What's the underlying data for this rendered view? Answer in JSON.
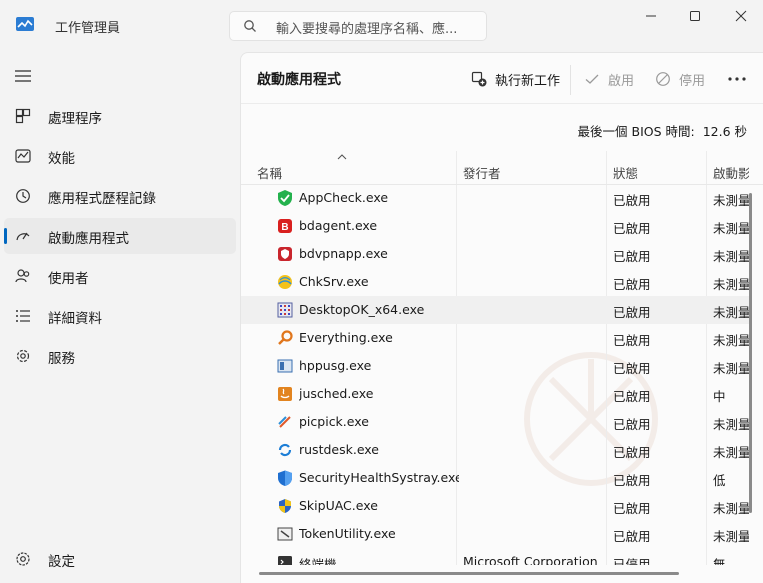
{
  "window": {
    "title": "工作管理員",
    "search_placeholder": "輸入要搜尋的處理序名稱、應..."
  },
  "sidebar": {
    "items": [
      {
        "label": "處理程序",
        "icon": "processes-icon"
      },
      {
        "label": "效能",
        "icon": "performance-icon"
      },
      {
        "label": "應用程式歷程記錄",
        "icon": "app-history-icon"
      },
      {
        "label": "啟動應用程式",
        "icon": "startup-apps-icon",
        "active": true
      },
      {
        "label": "使用者",
        "icon": "users-icon"
      },
      {
        "label": "詳細資料",
        "icon": "details-icon"
      },
      {
        "label": "服務",
        "icon": "services-icon"
      }
    ],
    "settings_label": "設定"
  },
  "main": {
    "title": "啟動應用程式",
    "toolbar": {
      "run_new_task": "執行新工作",
      "enable": "啟用",
      "disable": "停用"
    },
    "bios_label": "最後一個 BIOS 時間:",
    "bios_value": "12.6 秒",
    "columns": [
      "名稱",
      "發行者",
      "狀態",
      "啟動影響"
    ],
    "rows": [
      {
        "name": "AppCheck.exe",
        "publisher": "",
        "status": "已啟用",
        "impact": "未測量",
        "icon": "appcheck-icon"
      },
      {
        "name": "bdagent.exe",
        "publisher": "",
        "status": "已啟用",
        "impact": "未測量",
        "icon": "bitdefender-icon"
      },
      {
        "name": "bdvpnapp.exe",
        "publisher": "",
        "status": "已啟用",
        "impact": "未測量",
        "icon": "bdvpn-icon"
      },
      {
        "name": "ChkSrv.exe",
        "publisher": "",
        "status": "已啟用",
        "impact": "未測量",
        "icon": "chksrv-icon"
      },
      {
        "name": "DesktopOK_x64.exe",
        "publisher": "",
        "status": "已啟用",
        "impact": "未測量",
        "icon": "desktopok-icon"
      },
      {
        "name": "Everything.exe",
        "publisher": "",
        "status": "已啟用",
        "impact": "未測量",
        "icon": "everything-icon"
      },
      {
        "name": "hppusg.exe",
        "publisher": "",
        "status": "已啟用",
        "impact": "未測量",
        "icon": "hppusg-icon"
      },
      {
        "name": "jusched.exe",
        "publisher": "",
        "status": "已啟用",
        "impact": "中",
        "icon": "java-icon"
      },
      {
        "name": "picpick.exe",
        "publisher": "",
        "status": "已啟用",
        "impact": "未測量",
        "icon": "picpick-icon"
      },
      {
        "name": "rustdesk.exe",
        "publisher": "",
        "status": "已啟用",
        "impact": "未測量",
        "icon": "rustdesk-icon"
      },
      {
        "name": "SecurityHealthSystray.exe",
        "publisher": "",
        "status": "已啟用",
        "impact": "低",
        "icon": "security-shield-icon"
      },
      {
        "name": "SkipUAC.exe",
        "publisher": "",
        "status": "已啟用",
        "impact": "未測量",
        "icon": "skipuac-icon"
      },
      {
        "name": "TokenUtility.exe",
        "publisher": "",
        "status": "已啟用",
        "impact": "未測量",
        "icon": "tokenutility-icon"
      },
      {
        "name": "終端機",
        "publisher": "Microsoft Corporation",
        "status": "已停用",
        "impact": "無",
        "icon": "terminal-icon"
      }
    ]
  },
  "colors": {
    "accent": "#0067c0",
    "background": "#f3f3f3",
    "panel": "#fbfbfb",
    "hover_row": "#f0f0f0"
  }
}
